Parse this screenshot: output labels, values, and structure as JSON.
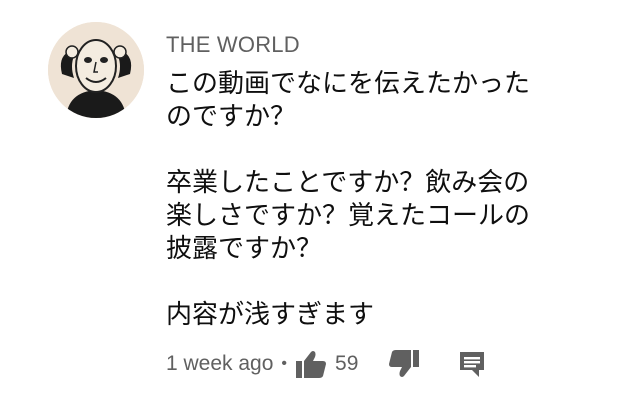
{
  "comment": {
    "author": "THE WORLD",
    "lines": [
      "この動画でなにを伝えたかった",
      "のですか？",
      "",
      "卒業したことですか？飲み会の",
      "楽しさですか？覚えたコールの",
      "披露ですか？",
      "",
      "内容が浅すぎます"
    ],
    "timestamp": "1 week ago",
    "separator": "•",
    "like_count": "59"
  },
  "icons": {
    "like": "thumbs-up-icon",
    "dislike": "thumbs-down-icon",
    "reply": "reply-comment-icon"
  }
}
